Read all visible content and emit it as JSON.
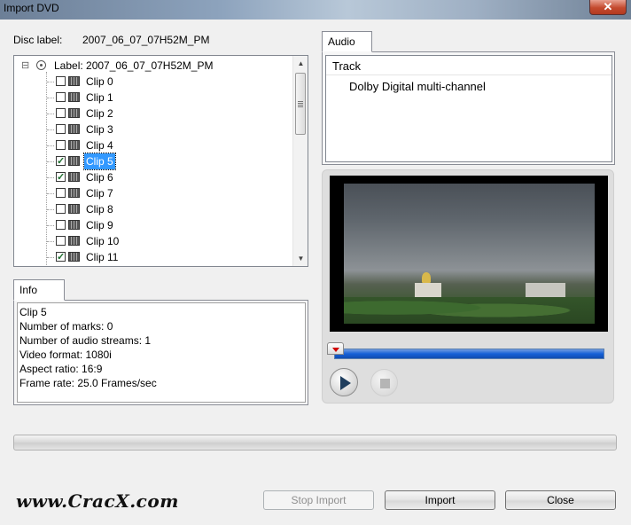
{
  "window": {
    "title": "Import DVD",
    "close_glyph": "✕"
  },
  "disc": {
    "label_caption": "Disc label:",
    "label_value": "2007_06_07_07H52M_PM"
  },
  "tree": {
    "expander_glyph": "⊟",
    "root_icon": "disc-icon",
    "root_label": "Label: 2007_06_07_07H52M_PM",
    "clips": [
      {
        "label": "Clip 0",
        "checked": false,
        "selected": false
      },
      {
        "label": "Clip 1",
        "checked": false,
        "selected": false
      },
      {
        "label": "Clip 2",
        "checked": false,
        "selected": false
      },
      {
        "label": "Clip 3",
        "checked": false,
        "selected": false
      },
      {
        "label": "Clip 4",
        "checked": false,
        "selected": false
      },
      {
        "label": "Clip 5",
        "checked": true,
        "selected": true
      },
      {
        "label": "Clip 6",
        "checked": true,
        "selected": false
      },
      {
        "label": "Clip 7",
        "checked": false,
        "selected": false
      },
      {
        "label": "Clip 8",
        "checked": false,
        "selected": false
      },
      {
        "label": "Clip 9",
        "checked": false,
        "selected": false
      },
      {
        "label": "Clip 10",
        "checked": false,
        "selected": false
      },
      {
        "label": "Clip 11",
        "checked": true,
        "selected": false
      }
    ],
    "scroll_up_glyph": "▲",
    "scroll_down_glyph": "▼"
  },
  "info": {
    "tab_label": "Info",
    "lines": [
      "Clip 5",
      "Number of marks: 0",
      "Number of audio streams: 1",
      "Video format: 1080i",
      "Aspect ratio: 16:9",
      "Frame rate: 25.0 Frames/sec"
    ]
  },
  "audio": {
    "tab_label": "Audio",
    "column_header": "Track",
    "tracks": [
      "Dolby Digital multi-channel"
    ]
  },
  "player": {
    "seek_position": 0,
    "play_icon": "play-icon",
    "stop_icon": "stop-icon",
    "seek_color": "#1560d8"
  },
  "import_progress": 0,
  "buttons": {
    "stop_import": "Stop Import",
    "import": "Import",
    "close": "Close"
  },
  "watermark": "www.CracX.com"
}
